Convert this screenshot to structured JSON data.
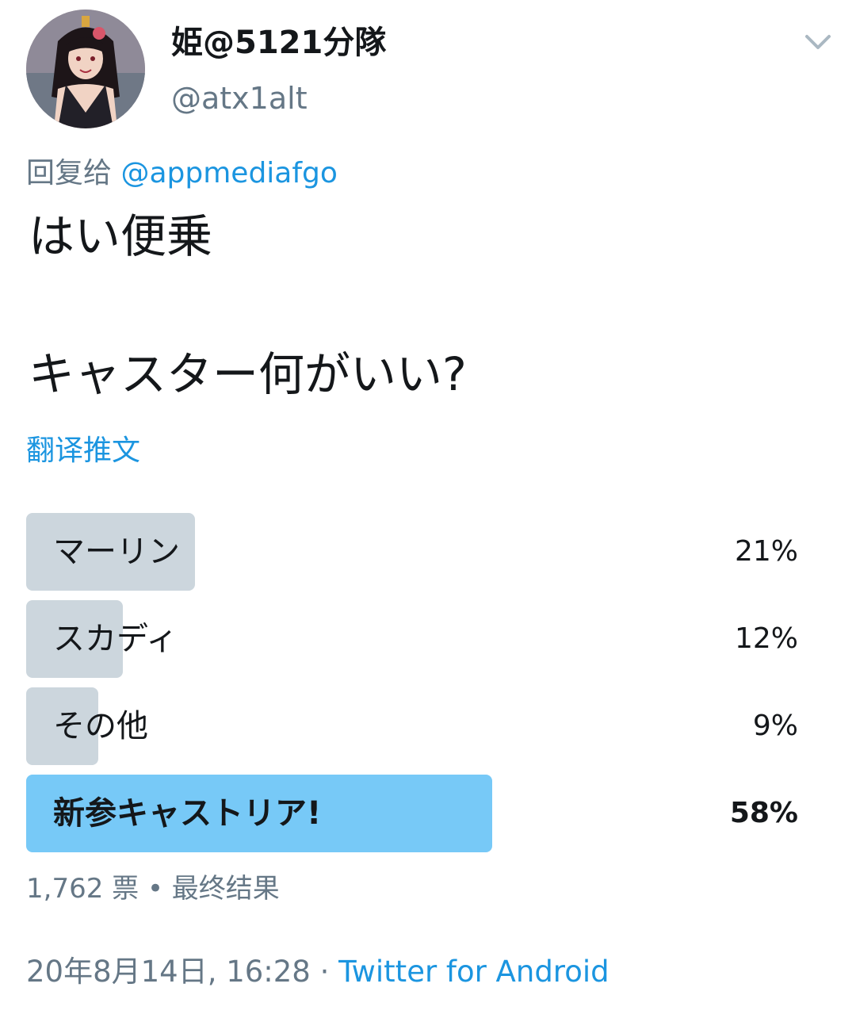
{
  "user": {
    "display_name": "姫@5121分隊",
    "handle": "@atx1alt",
    "avatar_icon": "avatar-image"
  },
  "reply": {
    "prefix": "回复给",
    "mention": "@appmediafgo"
  },
  "tweet": {
    "line1": "はい便乗",
    "line2": "キャスター何がいい?",
    "translate_label": "翻译推文"
  },
  "poll": {
    "options": [
      {
        "label": "マーリン",
        "percent_text": "21%",
        "percent": 21,
        "winner": false
      },
      {
        "label": "スカディ",
        "percent_text": "12%",
        "percent": 12,
        "winner": false
      },
      {
        "label": "その他",
        "percent_text": "9%",
        "percent": 9,
        "winner": false
      },
      {
        "label": "新参キャストリア!",
        "percent_text": "58%",
        "percent": 58,
        "winner": true
      }
    ],
    "meta": "1,762 票 • 最终结果"
  },
  "footer": {
    "timestamp": "20年8月14日, 16:28",
    "separator": "·",
    "source": "Twitter for Android"
  },
  "colors": {
    "link": "#1b95e0",
    "secondary_text": "#657786",
    "poll_bar": "#ccd6dd",
    "poll_bar_winner": "#77c9f7"
  }
}
